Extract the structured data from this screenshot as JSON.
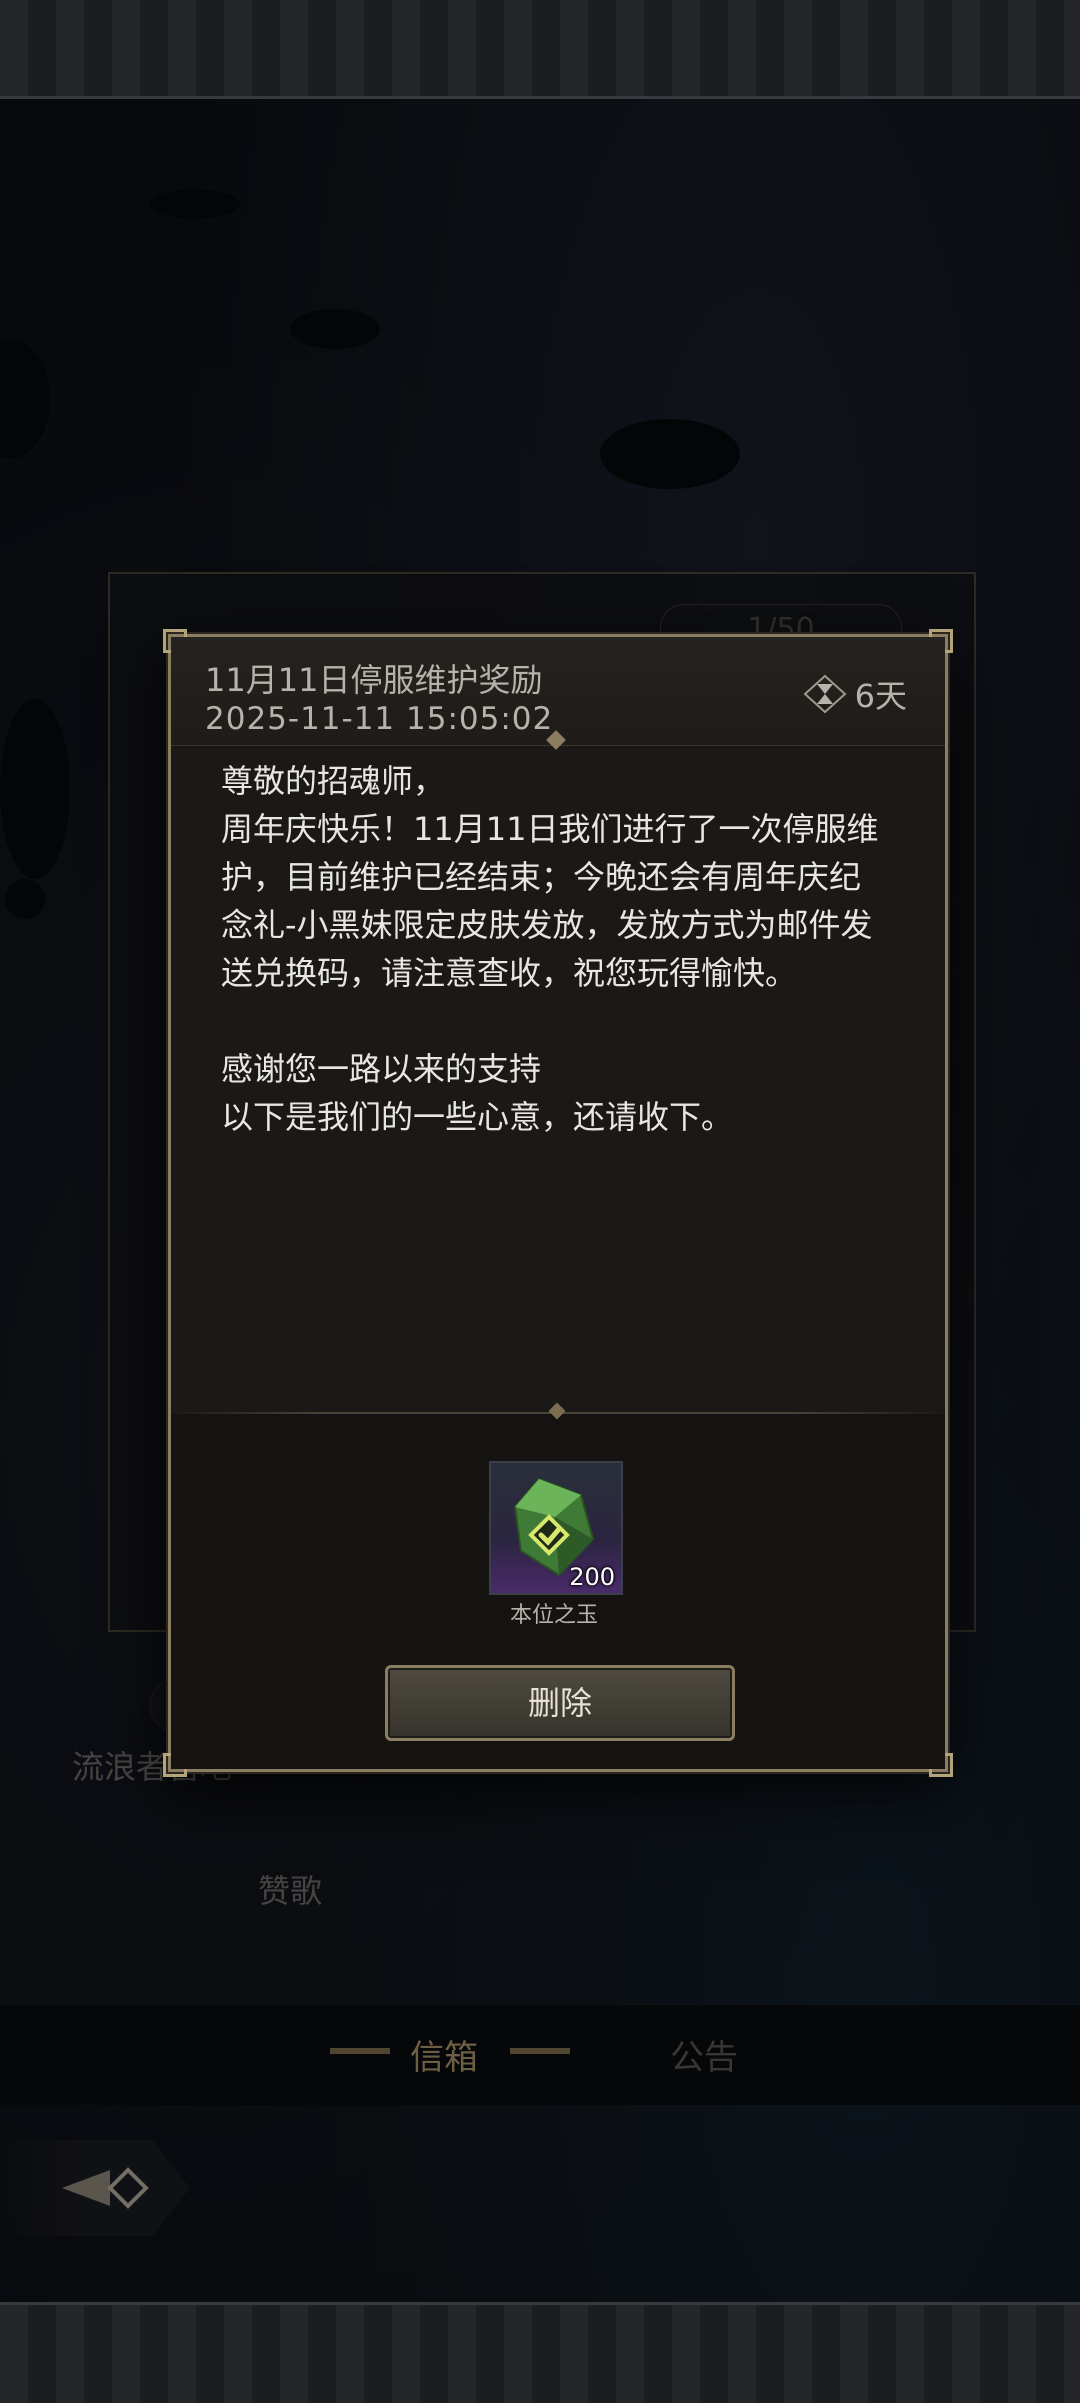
{
  "background": {
    "counter": "1/50",
    "sender_label": "流浪者营地",
    "praise_label": "赞歌",
    "tabs": [
      {
        "label": "信箱",
        "active": true
      },
      {
        "label": "公告",
        "active": false
      }
    ]
  },
  "mail": {
    "title": "11月11日停服维护奖励",
    "date": "2025-11-11  15:05:02",
    "expire": "6天",
    "greeting": "尊敬的招魂师，",
    "paragraph1": "周年庆快乐！11月11日我们进行了一次停服维护，目前维护已经结束；今晚还会有周年庆纪念礼-小黑妹限定皮肤发放，发放方式为邮件发送兑换码，请注意查收，祝您玩得愉快。",
    "paragraph2": "感谢您一路以来的支持",
    "paragraph3": "以下是我们的一些心意，还请收下。"
  },
  "attachment": {
    "item_name": "本位之玉",
    "count": "200",
    "icon": "green-crystal-icon",
    "claimed": true
  },
  "actions": {
    "delete_label": "删除"
  },
  "colors": {
    "frame_gold": "#8a7d60",
    "text_primary": "#e8e6e1",
    "text_secondary": "#b7b3ab",
    "crystal_green": "#5aa04a"
  }
}
